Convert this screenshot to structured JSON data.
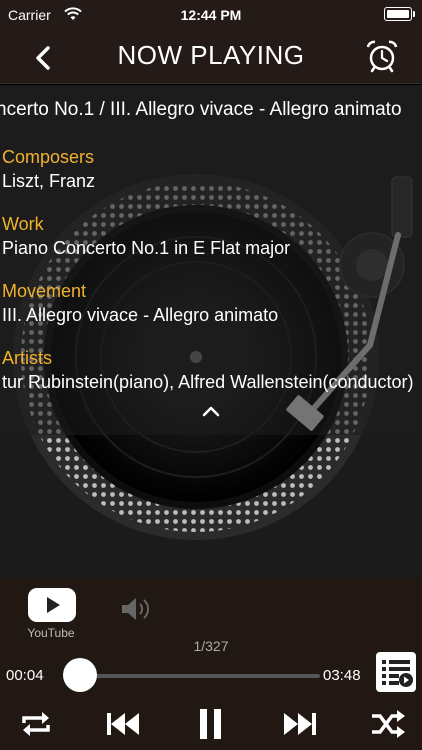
{
  "status_bar": {
    "carrier": "Carrier",
    "time": "12:44 PM"
  },
  "nav": {
    "title": "NOW PLAYING",
    "back_icon": "chevron-left-icon",
    "alarm_icon": "alarm-clock-icon"
  },
  "track": {
    "title": "ncerto No.1 / III. Allegro vivace - Allegro animato",
    "composers_label": "Composers",
    "composers": "Liszt, Franz",
    "work_label": "Work",
    "work": "Piano Concerto No.1 in E Flat major",
    "movement_label": "Movement",
    "movement": "III. Allegro vivace - Allegro animato",
    "artists_label": "Artists",
    "artists": "tur Rubinstein(piano), Alfred Wallenstein(conductor)"
  },
  "player": {
    "youtube_label": "YouTube",
    "track_count": "1/327",
    "elapsed": "00:04",
    "duration": "03:48",
    "progress": 0.018
  },
  "colors": {
    "accent": "#f0b22e",
    "bar": "#241b18"
  }
}
